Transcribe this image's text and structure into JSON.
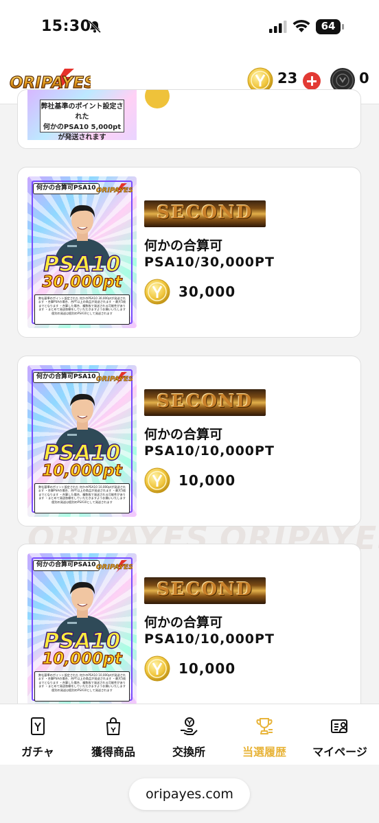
{
  "status_bar": {
    "time": "15:30",
    "battery": "64"
  },
  "header": {
    "logo_text": "ORIPAYES",
    "coin_count": "23",
    "dark_coin_count": "0"
  },
  "watermark_text": "ORIPAYES",
  "partial_card": {
    "notes": [
      "弊社基準のポイント設定された",
      "何かのPSA10 5,000pt",
      "が発送されます"
    ]
  },
  "cards": [
    {
      "tag": "何かの合算可PSA10",
      "psa": "PSA10",
      "pt": "30,000pt",
      "rank": "SECOND",
      "title1": "何かの合算可",
      "title2": "PSA10/30,000PT",
      "price": "30,000",
      "notes": "弊社基準のポイント設定された 何かのPSA10 30,000ptが発送されます ・合算PSAの場合、合PT以上の商品が発送されます ・最大5枚までとなります ・合算した場合、複数枚で発送される可能性があります ・まとめて発送依頼をしていただきますようお願いいたします 個別の発送は個別のPSA10として発送されます"
    },
    {
      "tag": "何かの合算可PSA10",
      "psa": "PSA10",
      "pt": "10,000pt",
      "rank": "SECOND",
      "title1": "何かの合算可",
      "title2": "PSA10/10,000PT",
      "price": "10,000",
      "notes": "弊社基準のポイント設定された 何かのPSA10 10,000ptが発送されます ・合算PSAの場合、合PT以上の商品が発送されます ・最大5枚までとなります ・合算した場合、複数枚で発送される可能性があります ・まとめて発送依頼をしていただきますようお願いいたします 個別の発送は個別のPSA10として発送されます"
    },
    {
      "tag": "何かの合算可PSA10",
      "psa": "PSA10",
      "pt": "10,000pt",
      "rank": "SECOND",
      "title1": "何かの合算可",
      "title2": "PSA10/10,000PT",
      "price": "10,000",
      "notes": "弊社基準のポイント設定された 何かのPSA10 10,000ptが発送されます ・合算PSAの場合、合PT以上の商品が発送されます ・最大5枚までとなります ・合算した場合、複数枚で発送される可能性があります ・まとめて発送依頼をしていただきますようお願いいたします 個別の発送は個別のPSA10として発送されます"
    }
  ],
  "bottom_nav": [
    {
      "label": "ガチャ",
      "icon": "gacha-card-icon",
      "active": false
    },
    {
      "label": "獲得商品",
      "icon": "shopping-bag-icon",
      "active": false
    },
    {
      "label": "交換所",
      "icon": "exchange-hand-coin-icon",
      "active": false
    },
    {
      "label": "当選履歴",
      "icon": "trophy-icon",
      "active": true
    },
    {
      "label": "マイページ",
      "icon": "profile-card-icon",
      "active": false
    }
  ],
  "browser": {
    "url": "oripayes.com"
  },
  "colors": {
    "accent_gold": "#e8b43a",
    "plus_red": "#e23a34",
    "card_border": "#dedede",
    "background": "#f3f3f3"
  }
}
